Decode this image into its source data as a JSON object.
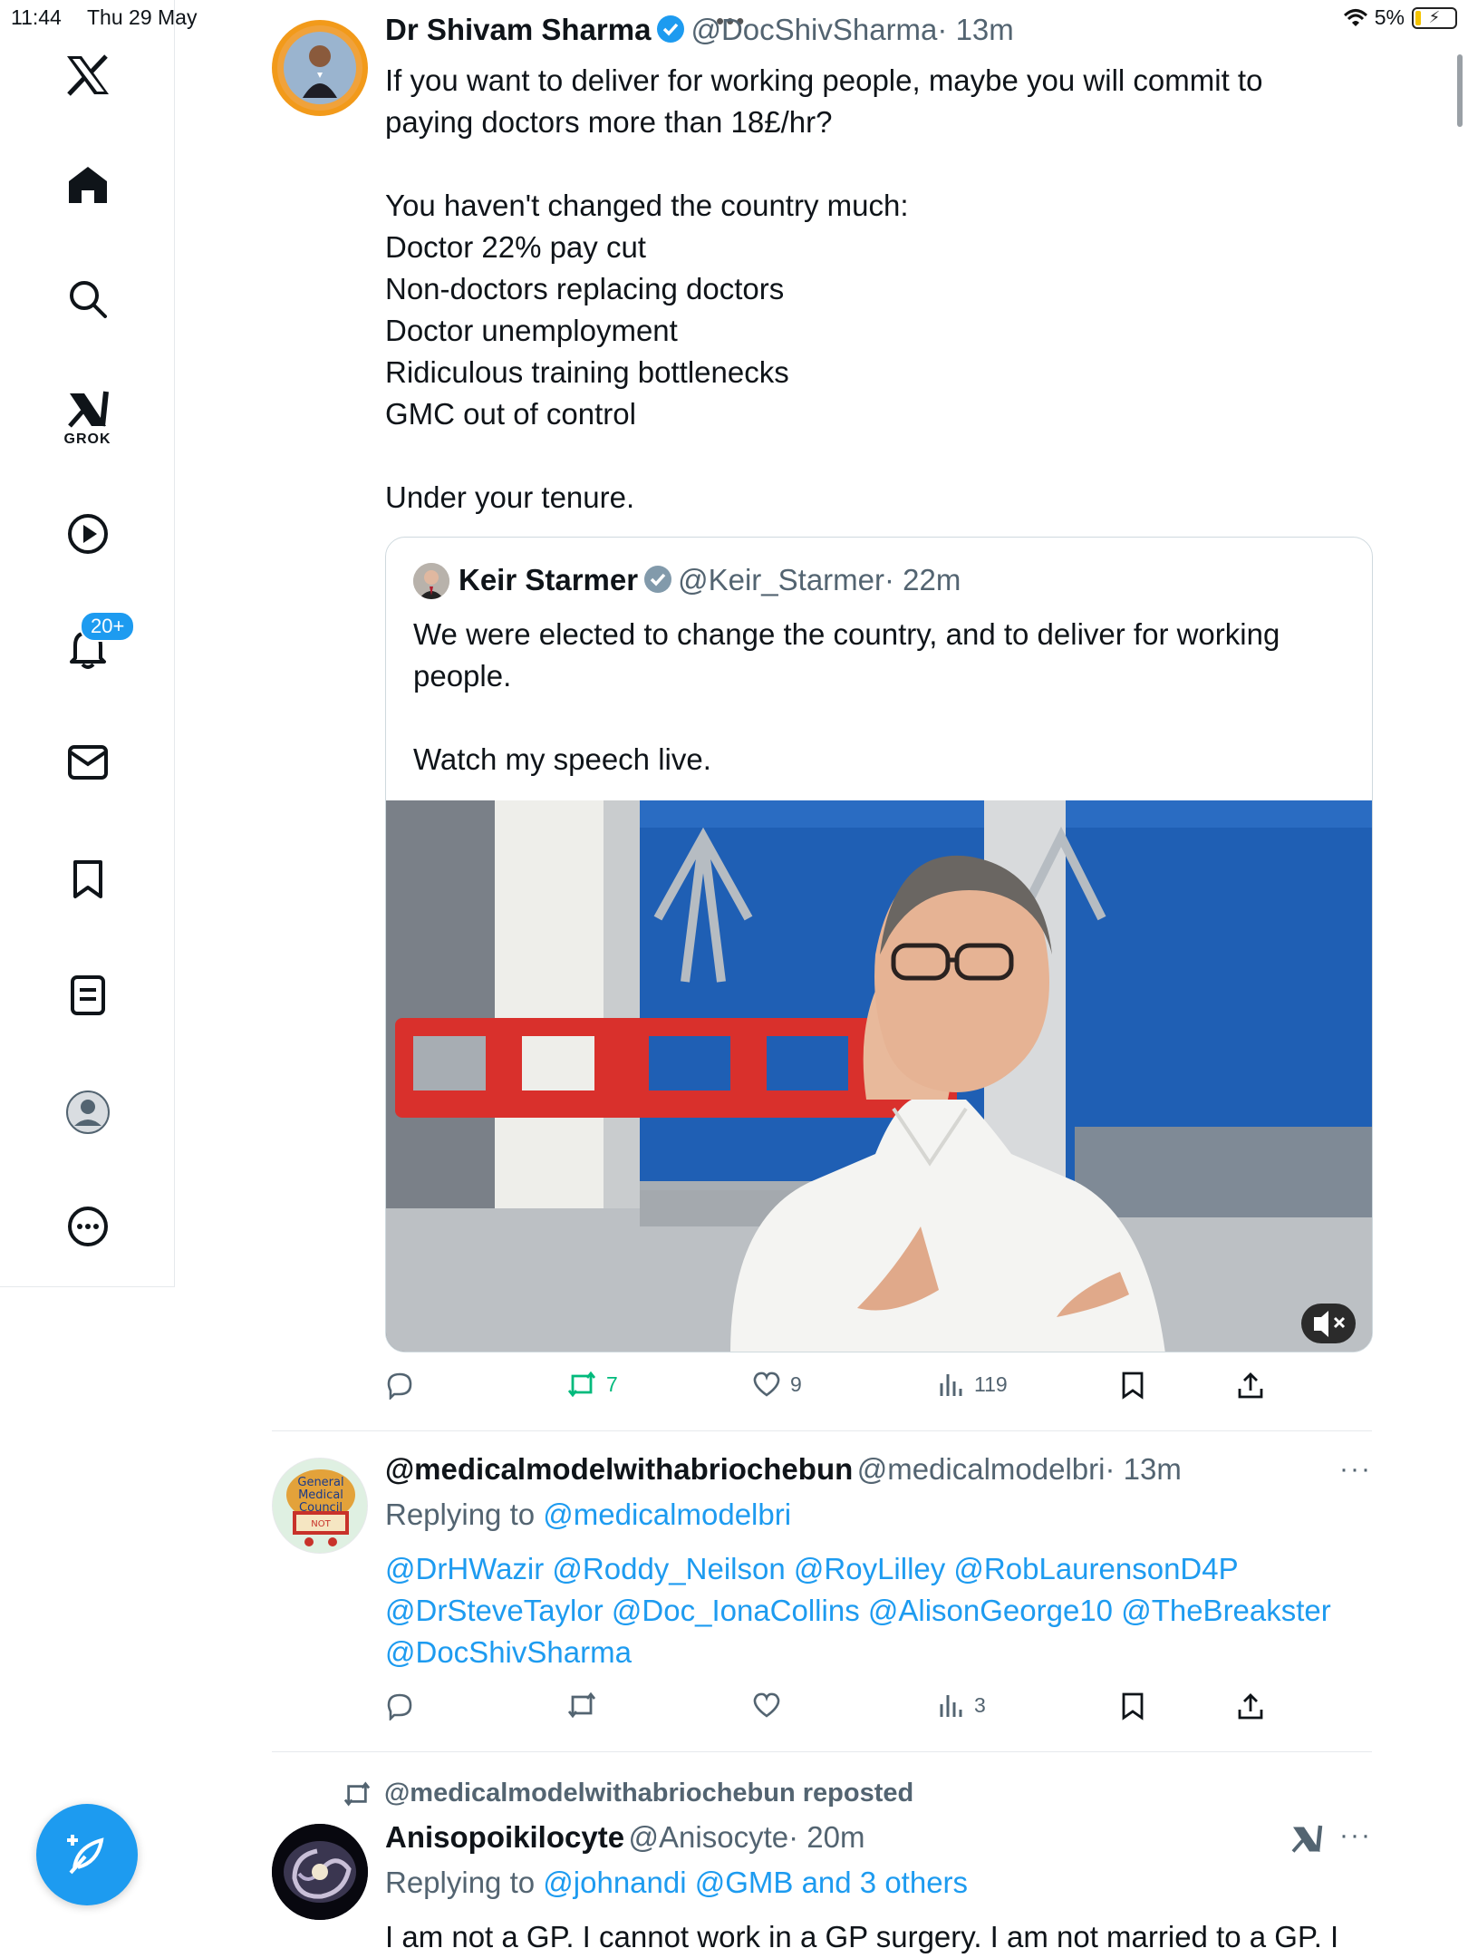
{
  "status_bar": {
    "time": "11:44",
    "date": "Thu 29 May",
    "battery": "5%"
  },
  "sidebar": {
    "items": [
      {
        "name": "home"
      },
      {
        "name": "search"
      },
      {
        "name": "grok",
        "label": "GROK"
      },
      {
        "name": "video"
      },
      {
        "name": "notifications",
        "badge": "20+"
      },
      {
        "name": "messages"
      },
      {
        "name": "bookmarks"
      },
      {
        "name": "lists"
      },
      {
        "name": "profile"
      },
      {
        "name": "more"
      }
    ]
  },
  "tweet1": {
    "author_name": "Dr Shivam Sharma",
    "author_handle": "@DocShivSharma",
    "time": "· 13m",
    "text": "If you want to deliver for working people, maybe you will commit to paying doctors more than 18£/hr?\n\nYou haven't changed the country much:\nDoctor 22% pay cut\nNon-doctors replacing doctors\nDoctor unemployment\nRidiculous training bottlenecks\nGMC out of control\n\nUnder your tenure.",
    "quote": {
      "author_name": "Keir Starmer",
      "author_handle": "@Keir_Starmer",
      "time": "· 22m",
      "text": "We were elected to change the country, and to deliver for working people.\n\nWatch my speech live."
    },
    "reposts": "7",
    "likes": "9",
    "views": "119"
  },
  "tweet2": {
    "author_name": "@medicalmodelwithabriochebun",
    "author_handle": "@medicalmodelbri",
    "time": "· 13m",
    "replying_prefix": "Replying to",
    "replying_to": "@medicalmodelbri",
    "mentions": "@DrHWazir @Roddy_Neilson @RoyLilley @RobLaurensonD4P @DrSteveTaylor @Doc_IonaCollins @AlisonGeorge10 @TheBreakster @DocShivSharma",
    "views": "3",
    "avatar_text": "General Medical Council NOT CONFIDENCE"
  },
  "tweet3": {
    "repost_banner": "@medicalmodelwithabriochebun reposted",
    "author_name": "Anisopoikilocyte",
    "author_handle": "@Anisocyte",
    "time": "· 20m",
    "replying_prefix": "Replying to",
    "replying_to": "@johnandi @GMB and 3 others",
    "text": "I am not a GP. I cannot work in a GP surgery. I am not married to a GP. I"
  },
  "colors": {
    "accent": "#1d9bf0",
    "repost_green": "#00ba7c",
    "muted": "#536471"
  }
}
